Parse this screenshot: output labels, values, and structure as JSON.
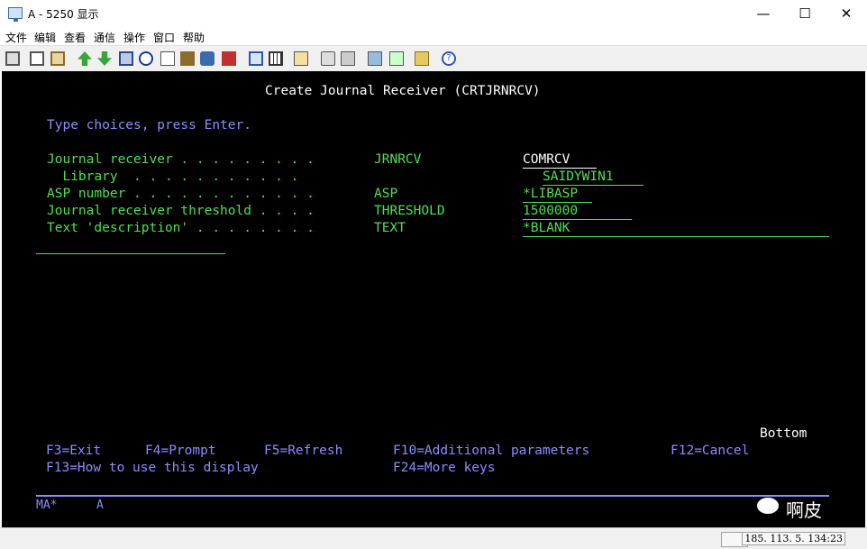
{
  "window": {
    "title": "A - 5250 显示",
    "minimize": "—",
    "maximize": "☐",
    "close": "✕"
  },
  "menu": [
    "文件",
    "编辑",
    "查看",
    "通信",
    "操作",
    "窗口",
    "帮助"
  ],
  "toolbar_icons": [
    "copy-icon",
    "paste-icon",
    "clipboard-icon",
    "upload-icon",
    "download-icon",
    "print-icon",
    "navigate-icon",
    "notes-icon",
    "book-icon",
    "macro-icon",
    "record-icon",
    "keyboard-icon",
    "grid-icon",
    "tools-icon",
    "stop-icon",
    "play-icon",
    "save-icon",
    "help-icon"
  ],
  "screen": {
    "title": "Create Journal Receiver (CRTJRNRCV)",
    "instruction": "Type choices, press Enter.",
    "params": [
      {
        "label": "Journal receiver . . . . . . . . .",
        "keyword": "JRNRCV",
        "value": "COMRCV"
      },
      {
        "label": "  Library  . . . . . . . . . . .",
        "keyword": "",
        "value": "SAIDYWIN1"
      },
      {
        "label": "ASP number . . . . . . . . . . . .",
        "keyword": "ASP",
        "value": "*LIBASP"
      },
      {
        "label": "Journal receiver threshold . . . .",
        "keyword": "THRESHOLD",
        "value": "1500000"
      },
      {
        "label": "Text 'description' . . . . . . . .",
        "keyword": "TEXT",
        "value": "*BLANK"
      }
    ],
    "bottom": "Bottom",
    "fkeys_row1": [
      "F3=Exit",
      "F4=Prompt",
      "F5=Refresh",
      "F10=Additional parameters",
      "F12=Cancel"
    ],
    "fkeys_row2": [
      "F13=How to use this display",
      "F24=More keys"
    ],
    "oia_left": "MA*",
    "oia_mode": "A"
  },
  "status": {
    "ip": "185. 113. 5. 134:23"
  },
  "watermark": "啊皮"
}
